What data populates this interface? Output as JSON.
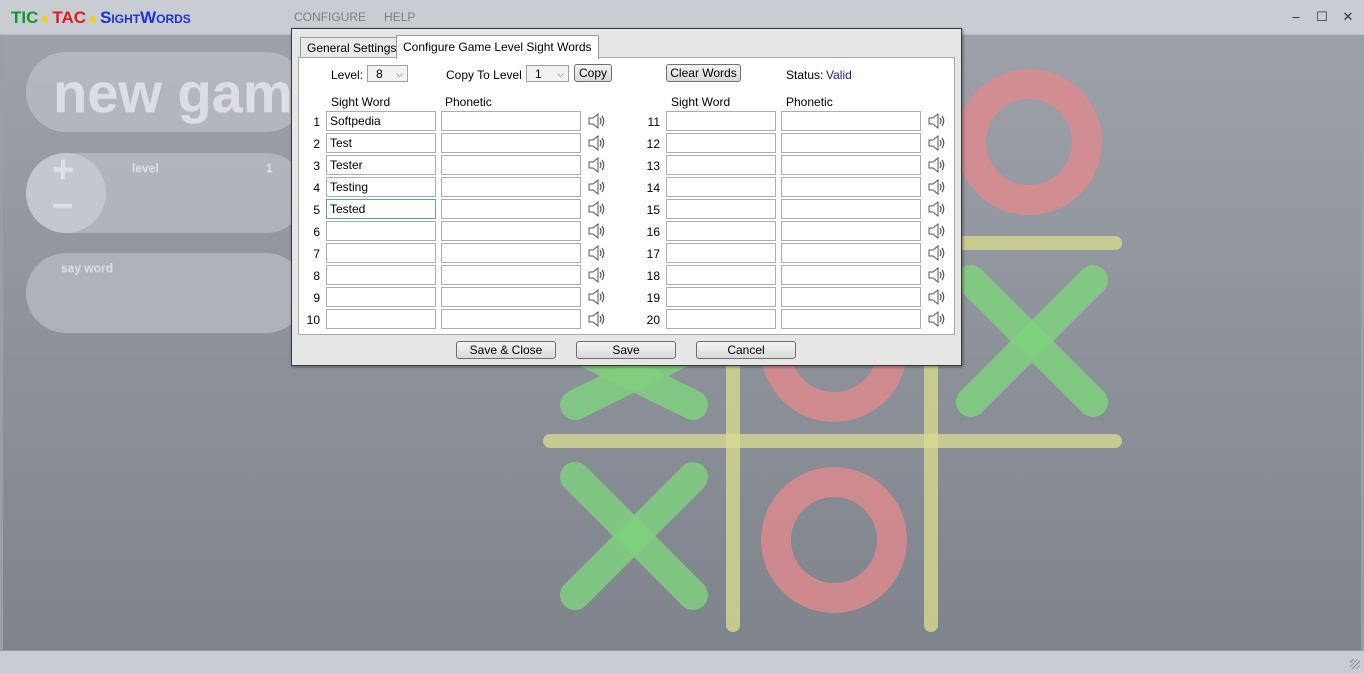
{
  "app": {
    "logo": {
      "tic": "TIC",
      "tac": "TAC",
      "sight": "SightWords"
    },
    "menu": [
      "CONFIGURE",
      "HELP"
    ],
    "window_controls": {
      "minimize": "–",
      "maximize": "☐",
      "close": "✕"
    }
  },
  "side_buttons": {
    "new_game": "new game",
    "level": "level",
    "level_value": "1",
    "level_plus": "+",
    "level_minus": "–",
    "say_word": "say word"
  },
  "dialog": {
    "tabs": [
      "General Settings",
      "Configure Game Level Sight Words"
    ],
    "active_tab": 1,
    "level_label": "Level:",
    "level_value": "8",
    "copy_to_label": "Copy To Level",
    "copy_to_value": "1",
    "copy_button": "Copy",
    "clear_button": "Clear Words",
    "status_label": "Status:",
    "status_value": "Valid",
    "headers": {
      "sight_word": "Sight Word",
      "phonetic": "Phonetic"
    },
    "words": [
      {
        "n": "1",
        "word": "Softpedia",
        "phonetic": ""
      },
      {
        "n": "2",
        "word": "Test",
        "phonetic": ""
      },
      {
        "n": "3",
        "word": "Tester",
        "phonetic": ""
      },
      {
        "n": "4",
        "word": "Testing",
        "phonetic": ""
      },
      {
        "n": "5",
        "word": "Tested",
        "phonetic": ""
      },
      {
        "n": "6",
        "word": "",
        "phonetic": ""
      },
      {
        "n": "7",
        "word": "",
        "phonetic": ""
      },
      {
        "n": "8",
        "word": "",
        "phonetic": ""
      },
      {
        "n": "9",
        "word": "",
        "phonetic": ""
      },
      {
        "n": "10",
        "word": "",
        "phonetic": ""
      },
      {
        "n": "11",
        "word": "",
        "phonetic": ""
      },
      {
        "n": "12",
        "word": "",
        "phonetic": ""
      },
      {
        "n": "13",
        "word": "",
        "phonetic": ""
      },
      {
        "n": "14",
        "word": "",
        "phonetic": ""
      },
      {
        "n": "15",
        "word": "",
        "phonetic": ""
      },
      {
        "n": "16",
        "word": "",
        "phonetic": ""
      },
      {
        "n": "17",
        "word": "",
        "phonetic": ""
      },
      {
        "n": "18",
        "word": "",
        "phonetic": ""
      },
      {
        "n": "19",
        "word": "",
        "phonetic": ""
      },
      {
        "n": "20",
        "word": "",
        "phonetic": ""
      }
    ],
    "focused_row": 4,
    "footer": {
      "save_close": "Save & Close",
      "save": "Save",
      "cancel": "Cancel"
    }
  },
  "colors": {
    "status_valid": "#1a1aa8",
    "x_mark": "#7fd07f",
    "o_mark": "#e08a8e",
    "grid_line": "#d6d98e"
  },
  "icons": {
    "speaker": "speaker-icon"
  }
}
